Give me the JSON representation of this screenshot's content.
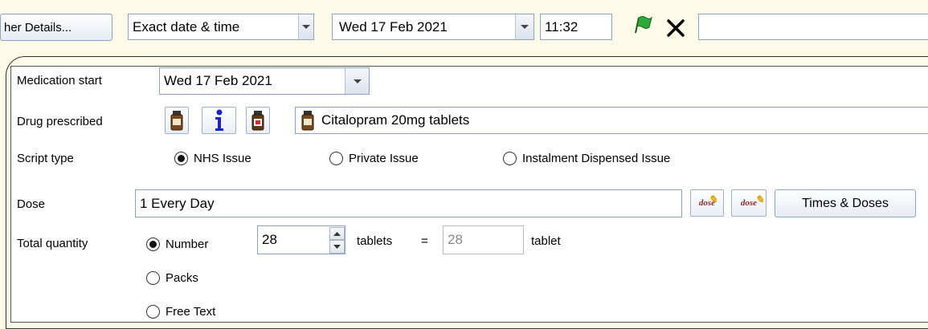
{
  "toolbar": {
    "other_details_label": "her Details...",
    "date_mode": "Exact date & time",
    "date_value": "Wed 17 Feb 2021",
    "time_value": "11:32",
    "free_text_value": ""
  },
  "form": {
    "medication_start": {
      "label": "Medication start",
      "value": "Wed 17 Feb 2021"
    },
    "drug_prescribed": {
      "label": "Drug prescribed",
      "value": "Citalopram 20mg tablets"
    },
    "script_type": {
      "label": "Script type",
      "options": [
        "NHS Issue",
        "Private Issue",
        "Instalment Dispensed Issue"
      ],
      "selected": "NHS Issue"
    },
    "dose": {
      "label": "Dose",
      "value": "1 Every Day",
      "times_doses_label": "Times & Doses",
      "dose_icon_text_1": "dose",
      "dose_icon_text_2": "dose"
    },
    "total_quantity": {
      "label": "Total quantity",
      "options": [
        "Number",
        "Packs",
        "Free Text"
      ],
      "selected": "Number",
      "number_value": "28",
      "unit_before_equals": "tablets",
      "equals": "=",
      "converted_value": "28",
      "converted_unit": "tablet"
    }
  },
  "colors": {
    "background": "#fffbe8",
    "border_accent": "#8aa4c8",
    "info_blue": "#1a22d6",
    "flag_green": "#2ea836",
    "bottle_brown": "#7a4a1e"
  }
}
